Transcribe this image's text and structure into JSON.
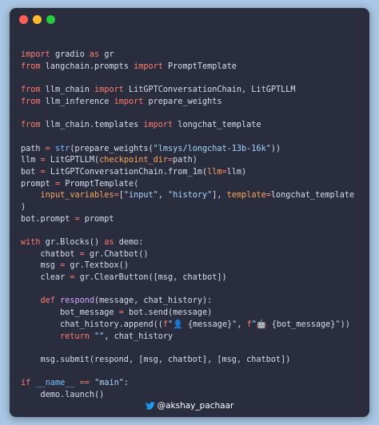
{
  "colors": {
    "background": "#a9c6e4",
    "window": "#2a2d3e",
    "keyword": "#ff7b72",
    "function": "#d2a8ff",
    "string": "#a5d6ff",
    "param": "#ffa657"
  },
  "icons": [
    "close-dot",
    "minimize-dot",
    "maximize-dot",
    "twitter-bird-icon"
  ],
  "code": {
    "lines": [
      [
        [
          "kw",
          "import"
        ],
        [
          "t",
          " gradio "
        ],
        [
          "kw",
          "as"
        ],
        [
          "t",
          " gr"
        ]
      ],
      [
        [
          "kw",
          "from"
        ],
        [
          "t",
          " langchain.prompts "
        ],
        [
          "kw",
          "import"
        ],
        [
          "t",
          " PromptTemplate"
        ]
      ],
      [],
      [
        [
          "kw",
          "from"
        ],
        [
          "t",
          " llm_chain "
        ],
        [
          "kw",
          "import"
        ],
        [
          "t",
          " LitGPTConversationChain, LitGPTLLM"
        ]
      ],
      [
        [
          "kw",
          "from"
        ],
        [
          "t",
          " llm_inference "
        ],
        [
          "kw",
          "import"
        ],
        [
          "t",
          " prepare_weights"
        ]
      ],
      [],
      [
        [
          "kw",
          "from"
        ],
        [
          "t",
          " llm_chain.templates "
        ],
        [
          "kw",
          "import"
        ],
        [
          "t",
          " longchat_template"
        ]
      ],
      [],
      [
        [
          "t",
          "path "
        ],
        [
          "op",
          "="
        ],
        [
          "t",
          " "
        ],
        [
          "bi",
          "str"
        ],
        [
          "t",
          "(prepare_weights("
        ],
        [
          "str",
          "\"lmsys/longchat-13b-16k\""
        ],
        [
          "t",
          "))"
        ]
      ],
      [
        [
          "t",
          "llm "
        ],
        [
          "op",
          "="
        ],
        [
          "t",
          " LitGPTLLM("
        ],
        [
          "param",
          "checkpoint_dir"
        ],
        [
          "op",
          "="
        ],
        [
          "t",
          "path)"
        ]
      ],
      [
        [
          "t",
          "bot "
        ],
        [
          "op",
          "="
        ],
        [
          "t",
          " LitGPTConversationChain.from_1m("
        ],
        [
          "param",
          "llm"
        ],
        [
          "op",
          "="
        ],
        [
          "t",
          "llm)"
        ]
      ],
      [
        [
          "t",
          "prompt "
        ],
        [
          "op",
          "="
        ],
        [
          "t",
          " PromptTemplate("
        ]
      ],
      [
        [
          "t",
          "    "
        ],
        [
          "param",
          "input_variables"
        ],
        [
          "op",
          "="
        ],
        [
          "t",
          "["
        ],
        [
          "str",
          "\"input\""
        ],
        [
          "t",
          ", "
        ],
        [
          "str",
          "\"history\""
        ],
        [
          "t",
          "], "
        ],
        [
          "param",
          "template"
        ],
        [
          "op",
          "="
        ],
        [
          "t",
          "longchat_template"
        ]
      ],
      [
        [
          "t",
          ")"
        ]
      ],
      [
        [
          "t",
          "bot.prompt "
        ],
        [
          "op",
          "="
        ],
        [
          "t",
          " prompt"
        ]
      ],
      [],
      [
        [
          "kw",
          "with"
        ],
        [
          "t",
          " gr.Blocks() "
        ],
        [
          "kw",
          "as"
        ],
        [
          "t",
          " demo:"
        ]
      ],
      [
        [
          "t",
          "    chatbot "
        ],
        [
          "op",
          "="
        ],
        [
          "t",
          " gr.Chatbot()"
        ]
      ],
      [
        [
          "t",
          "    msg "
        ],
        [
          "op",
          "="
        ],
        [
          "t",
          " gr.Textbox()"
        ]
      ],
      [
        [
          "t",
          "    clear "
        ],
        [
          "op",
          "="
        ],
        [
          "t",
          " gr.ClearButton([msg, chatbot])"
        ]
      ],
      [],
      [
        [
          "t",
          "    "
        ],
        [
          "kw",
          "def"
        ],
        [
          "t",
          " "
        ],
        [
          "fn",
          "respond"
        ],
        [
          "t",
          "(message, chat_history):"
        ]
      ],
      [
        [
          "t",
          "        bot_message "
        ],
        [
          "op",
          "="
        ],
        [
          "t",
          " bot.send(message)"
        ]
      ],
      [
        [
          "t",
          "        chat_history.append(("
        ],
        [
          "kw",
          "f"
        ],
        [
          "str",
          "\"👤 "
        ],
        [
          "t",
          "{message}"
        ],
        [
          "str",
          "\""
        ],
        [
          "t",
          ", "
        ],
        [
          "kw",
          "f"
        ],
        [
          "str",
          "\"🤖 "
        ],
        [
          "t",
          "{bot_message}"
        ],
        [
          "str",
          "\""
        ],
        [
          "t",
          "))"
        ]
      ],
      [
        [
          "t",
          "        "
        ],
        [
          "kw",
          "return"
        ],
        [
          "t",
          " "
        ],
        [
          "str",
          "\"\""
        ],
        [
          "t",
          ", chat_history"
        ]
      ],
      [],
      [
        [
          "t",
          "    msg.submit(respond, [msg, chatbot], [msg, chatbot])"
        ]
      ],
      [],
      [
        [
          "kw",
          "if"
        ],
        [
          "t",
          " "
        ],
        [
          "bi",
          "__name__"
        ],
        [
          "t",
          " "
        ],
        [
          "op",
          "=="
        ],
        [
          "t",
          " "
        ],
        [
          "str",
          "\"main\""
        ],
        [
          "t",
          ":"
        ]
      ],
      [
        [
          "t",
          "    demo.launch()"
        ]
      ]
    ]
  },
  "footer": {
    "handle": "@akshay_pachaar"
  }
}
